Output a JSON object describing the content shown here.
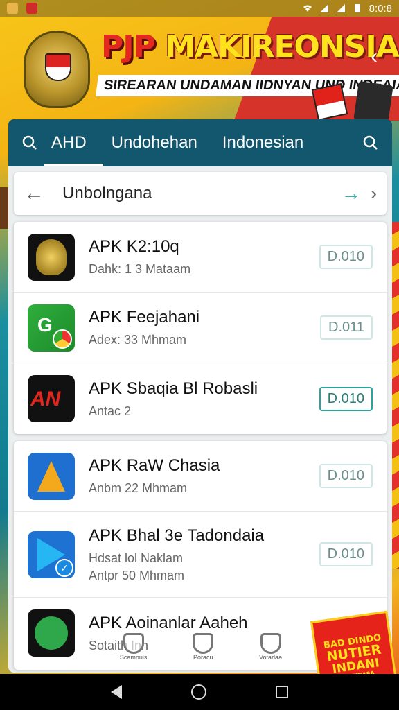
{
  "status_bar": {
    "time": "8:0:8"
  },
  "banner": {
    "title_part1": "PJP",
    "title_part2": " MAKIREONSIA",
    "subtitle": "SIREARAN UNDAMAN IIDNYAN UND INDEAIAN"
  },
  "tabs": [
    {
      "label": "AHD",
      "active": true
    },
    {
      "label": "Undohehan",
      "active": false
    },
    {
      "label": "Indonesian",
      "active": false
    }
  ],
  "breadcrumb": {
    "label": "Unbolngana"
  },
  "apps": [
    {
      "title": "APK K2:10q",
      "sub": "Dahk: 1 3  Mataam",
      "badge": "D.010",
      "icon": "emblem-icon"
    },
    {
      "title": "APK Feejahani",
      "sub": "Adex: 33 Mhmam",
      "badge": "D.011",
      "icon": "green-g-icon"
    },
    {
      "title": "APK Sbaqia Bl Robasli",
      "sub": "Antac 2",
      "badge": "D.010",
      "icon": "an-logo-icon",
      "highlight": true
    },
    {
      "title": "APK RaW Chasia",
      "sub": "Anbm 22 Mhmam",
      "badge": "D.010",
      "icon": "blue-arrow-icon"
    },
    {
      "title": "APK Bhal 3e Tadondaia",
      "sub": "Hdsat lol Naklam",
      "sub2": "Antpr 50 Mhmam",
      "badge": "D.010",
      "icon": "play-store-icon"
    },
    {
      "title": "APK Aoinanlar Aaheh",
      "sub": "Sotaith Inn",
      "icon": "whatsapp-icon"
    }
  ],
  "overlay_nav": [
    "Scamnuis",
    "Poracu",
    "Votarlaa"
  ],
  "promo": {
    "line1": "BAD DINDO",
    "line2": "NUTIER",
    "line3": "INDANI",
    "line4": "ROUNNASA"
  },
  "colors": {
    "tabbar": "#13576e",
    "accent_teal": "#2aa49a",
    "banner_yellow": "#ffe21c",
    "banner_red": "#e2281f"
  }
}
